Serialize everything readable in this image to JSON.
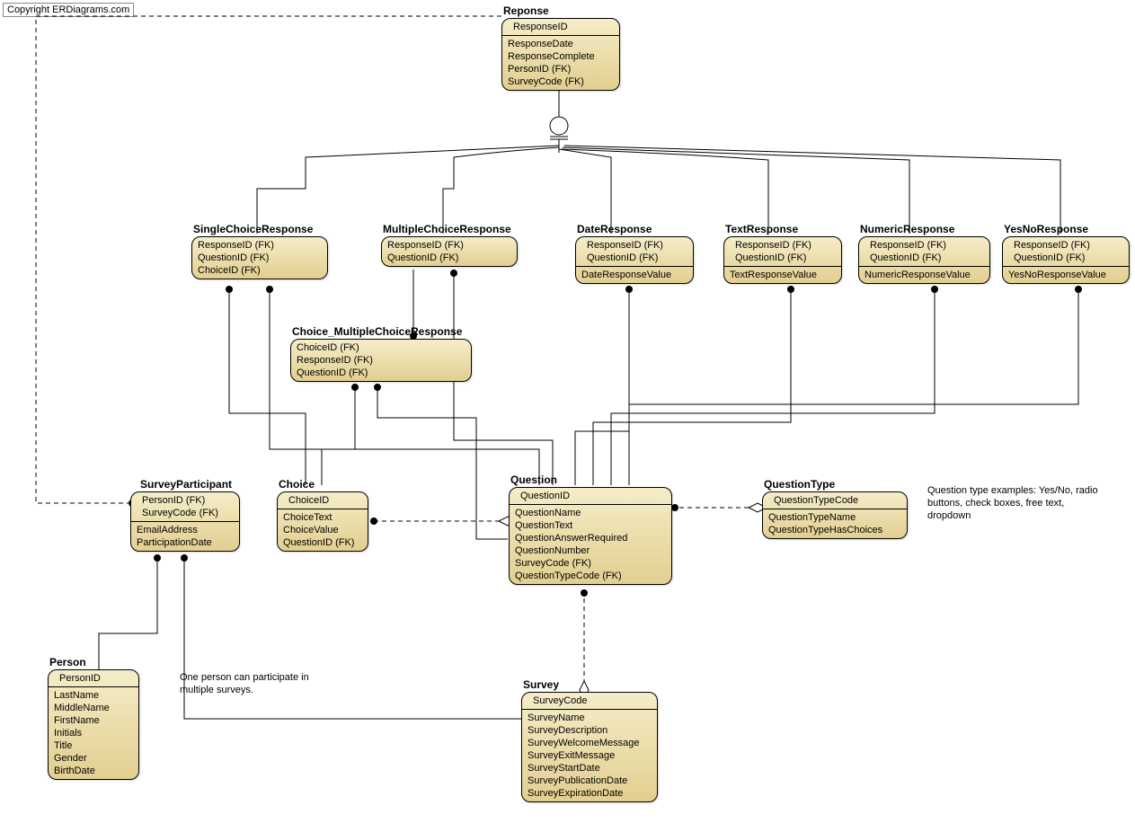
{
  "copyright": "Copyright ERDiagrams.com",
  "notes": {
    "questionType": "Question type examples: Yes/No, radio buttons, check boxes, free text, dropdown",
    "personSurvey": "One person can participate in multiple surveys."
  },
  "entities": {
    "Reponse": {
      "title": "Reponse",
      "key": [
        "ResponseID"
      ],
      "attrs": [
        "ResponseDate",
        "ResponseComplete",
        "PersonID (FK)",
        "SurveyCode (FK)"
      ]
    },
    "SingleChoiceResponse": {
      "title": "SingleChoiceResponse",
      "attrs": [
        "ResponseID (FK)",
        "QuestionID (FK)",
        "ChoiceID (FK)"
      ]
    },
    "MultipleChoiceResponse": {
      "title": "MultipleChoiceResponse",
      "attrs": [
        "ResponseID (FK)",
        "QuestionID (FK)"
      ]
    },
    "DateResponse": {
      "title": "DateResponse",
      "attrs": [
        "ResponseID (FK)",
        "QuestionID (FK)",
        "DateResponseValue"
      ]
    },
    "TextResponse": {
      "title": "TextResponse",
      "attrs": [
        "ResponseID (FK)",
        "QuestionID (FK)",
        "TextResponseValue"
      ]
    },
    "NumericResponse": {
      "title": "NumericResponse",
      "attrs": [
        "ResponseID (FK)",
        "QuestionID (FK)",
        "NumericResponseValue"
      ]
    },
    "YesNoResponse": {
      "title": "YesNoResponse",
      "attrs": [
        "ResponseID (FK)",
        "QuestionID (FK)",
        "YesNoResponseValue"
      ]
    },
    "Choice_MultipleChoiceResponse": {
      "title": "Choice_MultipleChoiceResponse",
      "attrs": [
        "ChoiceID (FK)",
        "ResponseID (FK)",
        "QuestionID (FK)"
      ]
    },
    "SurveyParticipant": {
      "title": "SurveyParticipant",
      "key": [
        "PersonID (FK)",
        "SurveyCode (FK)"
      ],
      "attrs": [
        "EmailAddress",
        "ParticipationDate"
      ]
    },
    "Choice": {
      "title": "Choice",
      "key": [
        "ChoiceID"
      ],
      "attrs": [
        "ChoiceText",
        "ChoiceValue",
        "QuestionID (FK)"
      ]
    },
    "Question": {
      "title": "Question",
      "key": [
        "QuestionID"
      ],
      "attrs": [
        "QuestionName",
        "QuestionText",
        "QuestionAnswerRequired",
        "QuestionNumber",
        "SurveyCode (FK)",
        "QuestionTypeCode (FK)"
      ]
    },
    "QuestionType": {
      "title": "QuestionType",
      "key": [
        "QuestionTypeCode"
      ],
      "attrs": [
        "QuestionTypeName",
        "QuestionTypeHasChoices"
      ]
    },
    "Person": {
      "title": "Person",
      "key": [
        "PersonID"
      ],
      "attrs": [
        "LastName",
        "MiddleName",
        "FirstName",
        "Initials",
        "Title",
        "Gender",
        "BirthDate"
      ]
    },
    "Survey": {
      "title": "Survey",
      "key": [
        "SurveyCode"
      ],
      "attrs": [
        "SurveyName",
        "SurveyDescription",
        "SurveyWelcomeMessage",
        "SurveyExitMessage",
        "SurveyStartDate",
        "SurveyPublicationDate",
        "SurveyExpirationDate"
      ]
    }
  }
}
